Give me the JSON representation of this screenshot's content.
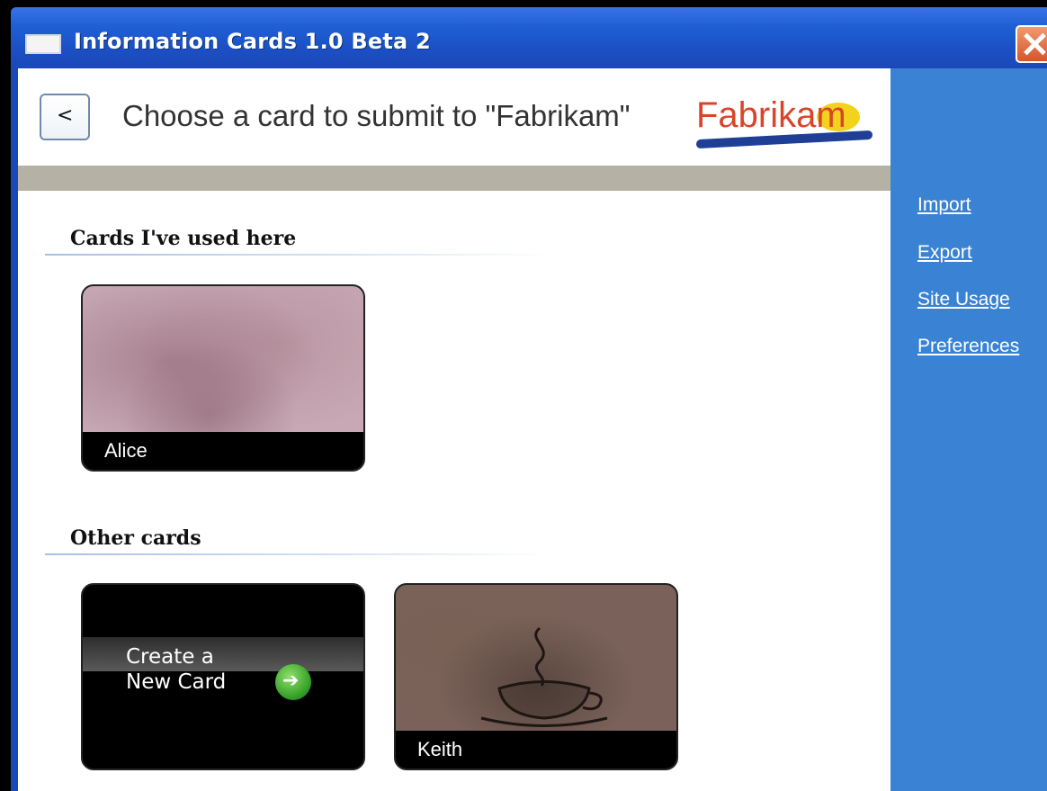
{
  "window": {
    "title": "Information Cards 1.0 Beta 2"
  },
  "header": {
    "title": "Choose a card to submit to \"Fabrikam\"",
    "back_label": "<",
    "logo_text": "Fabrikam"
  },
  "sections": {
    "used": {
      "title": "Cards I've used here"
    },
    "other": {
      "title": "Other cards"
    }
  },
  "cards": {
    "alice": {
      "label": "Alice"
    },
    "new_card": {
      "line1": "Create a",
      "line2": "New Card"
    },
    "keith": {
      "label": "Keith"
    }
  },
  "sidebar": {
    "links": [
      {
        "label": "Import"
      },
      {
        "label": "Export"
      },
      {
        "label": "Site Usage"
      },
      {
        "label": "Preferences"
      }
    ]
  },
  "colors": {
    "titlebar": "#1f5fd6",
    "sidebar": "#3a82d3",
    "band": "#b5b1a4",
    "logo": "#d9452b"
  },
  "icons": {
    "window": "window-icon",
    "close": "close-icon",
    "back": "back-arrow-icon",
    "new_card": "green-arrow-icon",
    "keith_card": "coffee-cup-icon"
  }
}
